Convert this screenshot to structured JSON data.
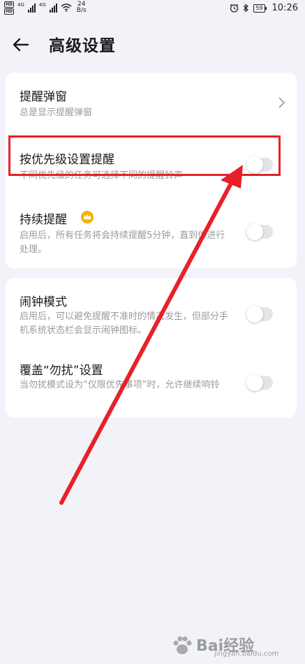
{
  "status_bar": {
    "sim1_label": "HD",
    "sim2_label": "HD",
    "net1": "4G",
    "net2": "4G",
    "speed_value": "24",
    "speed_unit": "B/s",
    "battery": "59",
    "time": "10:26"
  },
  "header": {
    "title": "高级设置"
  },
  "card1": {
    "items": [
      {
        "title": "提醒弹窗",
        "subtitle": "总是显示提醒弹窗",
        "control": "chevron"
      },
      {
        "title": "按优先级设置提醒",
        "subtitle": "不同优先级的任务可选择不同的提醒铃声",
        "control": "toggle",
        "on": false
      },
      {
        "title": "持续提醒",
        "subtitle": "启用后，所有任务将会持续提醒5分钟，直到你进行处理。",
        "control": "toggle",
        "on": false,
        "badge": "crown-icon"
      }
    ]
  },
  "card2": {
    "items": [
      {
        "title": "闹钟模式",
        "subtitle": "启用后，可以避免提醒不准时的情况发生，但部分手机系统状态栏会显示闹钟图标。",
        "control": "toggle",
        "on": false
      },
      {
        "title": "覆盖“勿扰”设置",
        "subtitle": "当勿扰模式设为“仅限优先事项”时，允许继续响铃",
        "control": "toggle",
        "on": false
      }
    ]
  },
  "annotation": {
    "box_color": "#e8202a",
    "arrow_color": "#e8202a"
  },
  "watermark": {
    "text": "Bai经验",
    "url": "jingyan.baidu.com"
  }
}
